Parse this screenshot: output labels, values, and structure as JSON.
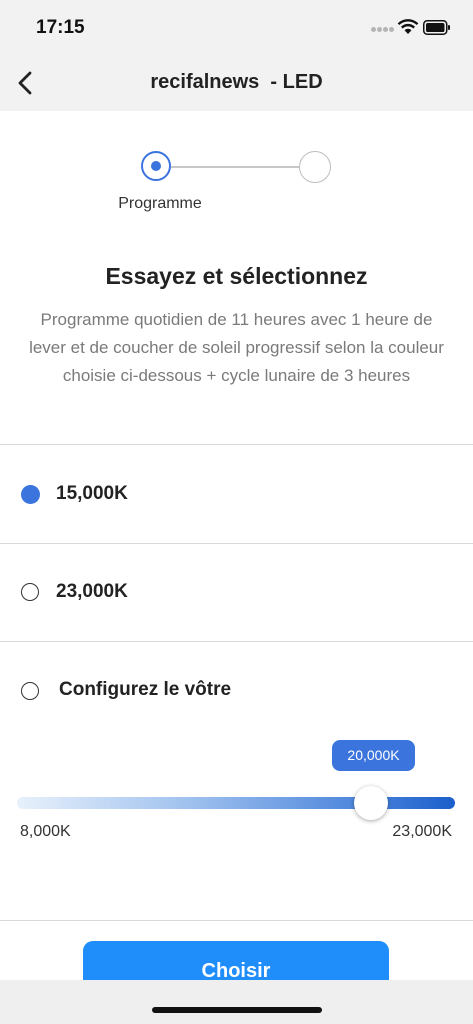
{
  "status_bar": {
    "time": "17:15",
    "icons": [
      "signal-dots-icon",
      "wifi-icon",
      "battery-icon"
    ]
  },
  "nav": {
    "title": "recifalnews  - LED",
    "back_icon": "chevron-left-icon"
  },
  "stepper": {
    "step_label": "Programme",
    "current_step": 1,
    "total_steps": 2
  },
  "intro": {
    "heading": "Essayez et sélectionnez",
    "description": "Programme quotidien de 11 heures avec 1 heure de lever et de coucher de soleil progressif selon la couleur choisie ci-dessous + cycle lunaire de 3 heures"
  },
  "options": [
    {
      "label": "15,000K",
      "selected": true
    },
    {
      "label": "23,000K",
      "selected": false
    },
    {
      "label": "Configurez le vôtre",
      "selected": false
    }
  ],
  "slider": {
    "value_label": "20,000K",
    "value": 20000,
    "min_label": "8,000K",
    "max_label": "23,000K",
    "min": 8000,
    "max": 23000
  },
  "action": {
    "label": "Choisir"
  },
  "colors": {
    "accent": "#3b74dd",
    "button": "#1f8efa",
    "bar_bg": "#f2f2f2"
  }
}
